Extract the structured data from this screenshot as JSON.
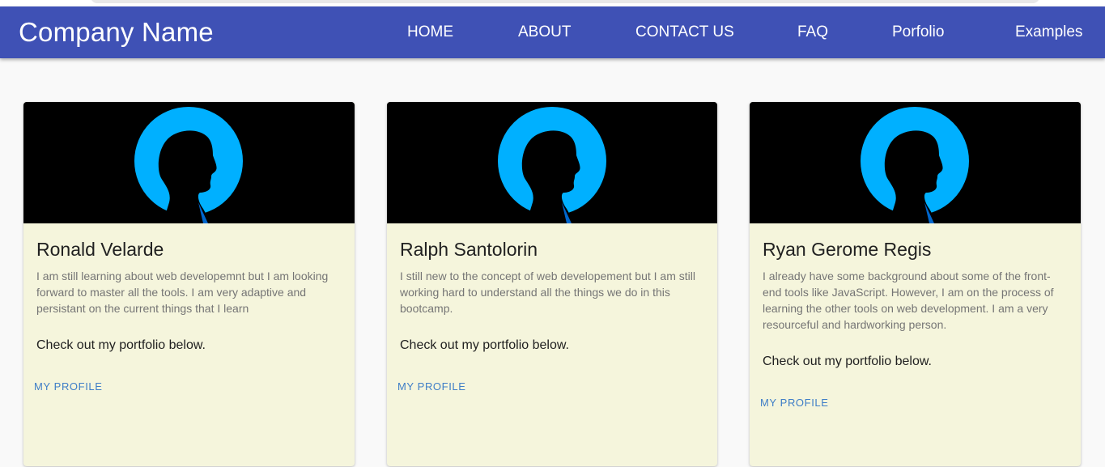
{
  "header": {
    "brand": "Company Name",
    "nav": [
      {
        "label": "HOME"
      },
      {
        "label": "ABOUT"
      },
      {
        "label": "CONTACT US"
      },
      {
        "label": "FAQ"
      },
      {
        "label": "Porfolio"
      },
      {
        "label": "Examples"
      }
    ]
  },
  "cards": [
    {
      "name": "Ronald Velarde",
      "description": "I am still learning about web developemnt but I am looking forward to master all the tools. I am very adaptive and persistant on the current things that I learn",
      "cta": "Check out my portfolio below.",
      "button": "MY PROFILE",
      "image_icon": "person-silhouette-icon"
    },
    {
      "name": "Ralph Santolorin",
      "description": "I still new to the concept of web developement but I am still working hard to understand all the things we do in this bootcamp.",
      "cta": "Check out my portfolio below.",
      "button": "MY PROFILE",
      "image_icon": "person-silhouette-icon"
    },
    {
      "name": "Ryan Gerome Regis",
      "description": "I already have some background about some of the front-end tools like JavaScript. However, I am on the process of learning the other tools on web development. I am a very resourceful and hardworking person.",
      "cta": "Check out my portfolio below.",
      "button": "MY PROFILE",
      "image_icon": "person-silhouette-icon"
    }
  ],
  "colors": {
    "appbar": "#3f51b5",
    "card_background": "#f5f5dc",
    "avatar_circle": "#00b0ff",
    "link": "#3f7ec7"
  }
}
